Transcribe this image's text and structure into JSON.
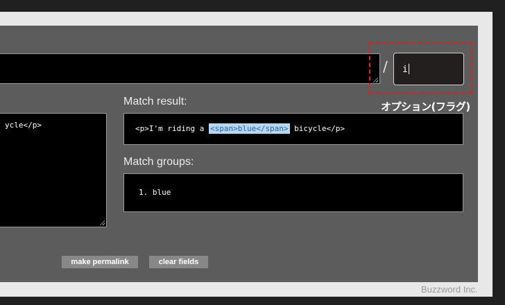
{
  "options": {
    "separator": "/",
    "flags_value": "i",
    "annotation_label": "オプション(フラグ)"
  },
  "test_string": {
    "visible_text": "ycle</p>"
  },
  "match_result": {
    "label": "Match result:",
    "before": "<p>I'm riding a ",
    "highlighted": "<span>blue</span>",
    "after": " bicycle</p>"
  },
  "match_groups": {
    "label": "Match groups:",
    "items": [
      "1. blue"
    ]
  },
  "buttons": {
    "permalink_label": "make permalink",
    "clear_label": "clear fields"
  },
  "footer": {
    "brand": "Buzzword Inc."
  },
  "colors": {
    "highlight_border": "#e0201e",
    "match_highlight_bg": "#b9d6f0",
    "match_highlight_text": "#1c63a6"
  }
}
